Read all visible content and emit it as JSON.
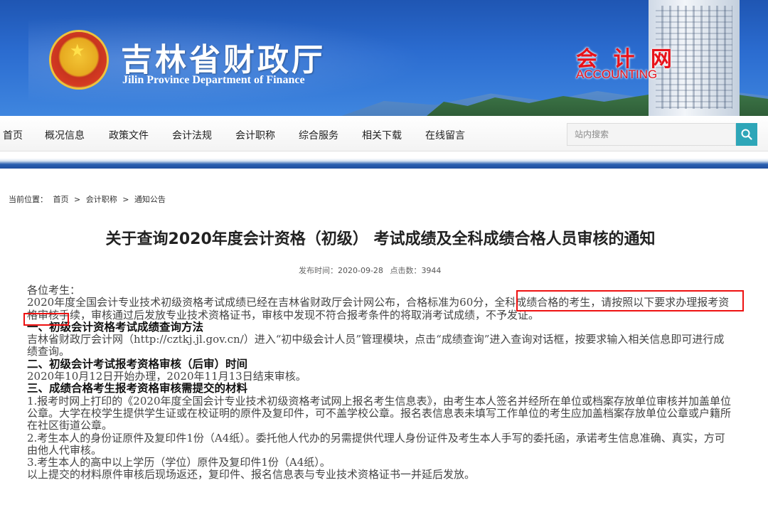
{
  "header": {
    "site_title": "吉林省财政厅",
    "site_subtitle": "Jilin Province Department of Finance",
    "brand_cn": "会 计 网",
    "brand_en": "ACCOUNTING"
  },
  "nav": {
    "items": [
      "首页",
      "概况信息",
      "政策文件",
      "会计法规",
      "会计职称",
      "综合服务",
      "相关下载",
      "在线留言"
    ],
    "search_placeholder": "站内搜索"
  },
  "breadcrumb": {
    "label": "当前位置：",
    "items": [
      "首页",
      ">",
      "会计职称",
      ">",
      "通知公告"
    ]
  },
  "article": {
    "title": "关于查询2020年度会计资格（初级） 考试成绩及全科成绩合格人员审核的通知",
    "publish_label": "发布时间：",
    "publish_time": "2020-09-28",
    "clicks_label": "点击数：",
    "clicks": "3944",
    "paragraphs": [
      {
        "type": "text",
        "text": "各位考生："
      },
      {
        "type": "text",
        "text": "2020年度全国会计专业技术初级资格考试成绩已经在吉林省财政厅会计网公布，合格标准为60分，全科成绩合格的考生，请按照以下要求办理报考资格审核手续，审核通过后发放专业技术资格证书，审核中发现不符合报考条件的将取消考试成绩，不予发证。"
      },
      {
        "type": "heading",
        "text": "一、初级会计资格考试成绩查询方法"
      },
      {
        "type": "text",
        "text": "吉林省财政厅会计网（http://cztkj.jl.gov.cn/）进入“初中级会计人员”管理模块，点击“成绩查询”进入查询对话框，按要求输入相关信息即可进行成绩查询。"
      },
      {
        "type": "heading",
        "text": "二、初级会计考试报考资格审核（后审）时间"
      },
      {
        "type": "text",
        "text": "2020年10月12日开始办理，2020年11月13日结束审核。"
      },
      {
        "type": "heading",
        "text": "三、成绩合格考生报考资格审核需提交的材料"
      },
      {
        "type": "text",
        "text": "1.报考时网上打印的《2020年度全国会计专业技术初级资格考试网上报名考生信息表》，由考生本人签名并经所在单位或档案存放单位审核并加盖单位公章。大学在校学生提供学生证或在校证明的原件及复印件，可不盖学校公章。报名表信息表未填写工作单位的考生应加盖档案存放单位公章或户籍所在社区街道公章。"
      },
      {
        "type": "text",
        "text": "2.考生本人的身份证原件及复印件1份（A4纸）。委托他人代办的另需提供代理人身份证件及考生本人手写的委托函，承诺考生信息准确、真实，方可由他人代审核。"
      },
      {
        "type": "text",
        "text": "3.考生本人的高中以上学历（学位）原件及复印件1份（A4纸）。"
      },
      {
        "type": "text",
        "text": "以上提交的材料原件审核后现场返还，复印件、报名信息表与专业技术资格证书一并延后发放。"
      }
    ]
  },
  "colors": {
    "banner": "#2b6cd0",
    "brand_red": "#e8121a",
    "search_button": "#2ea6b8",
    "highlight": "#ee1111"
  },
  "icons": {
    "emblem": "national-emblem-icon",
    "search": "search-icon"
  }
}
